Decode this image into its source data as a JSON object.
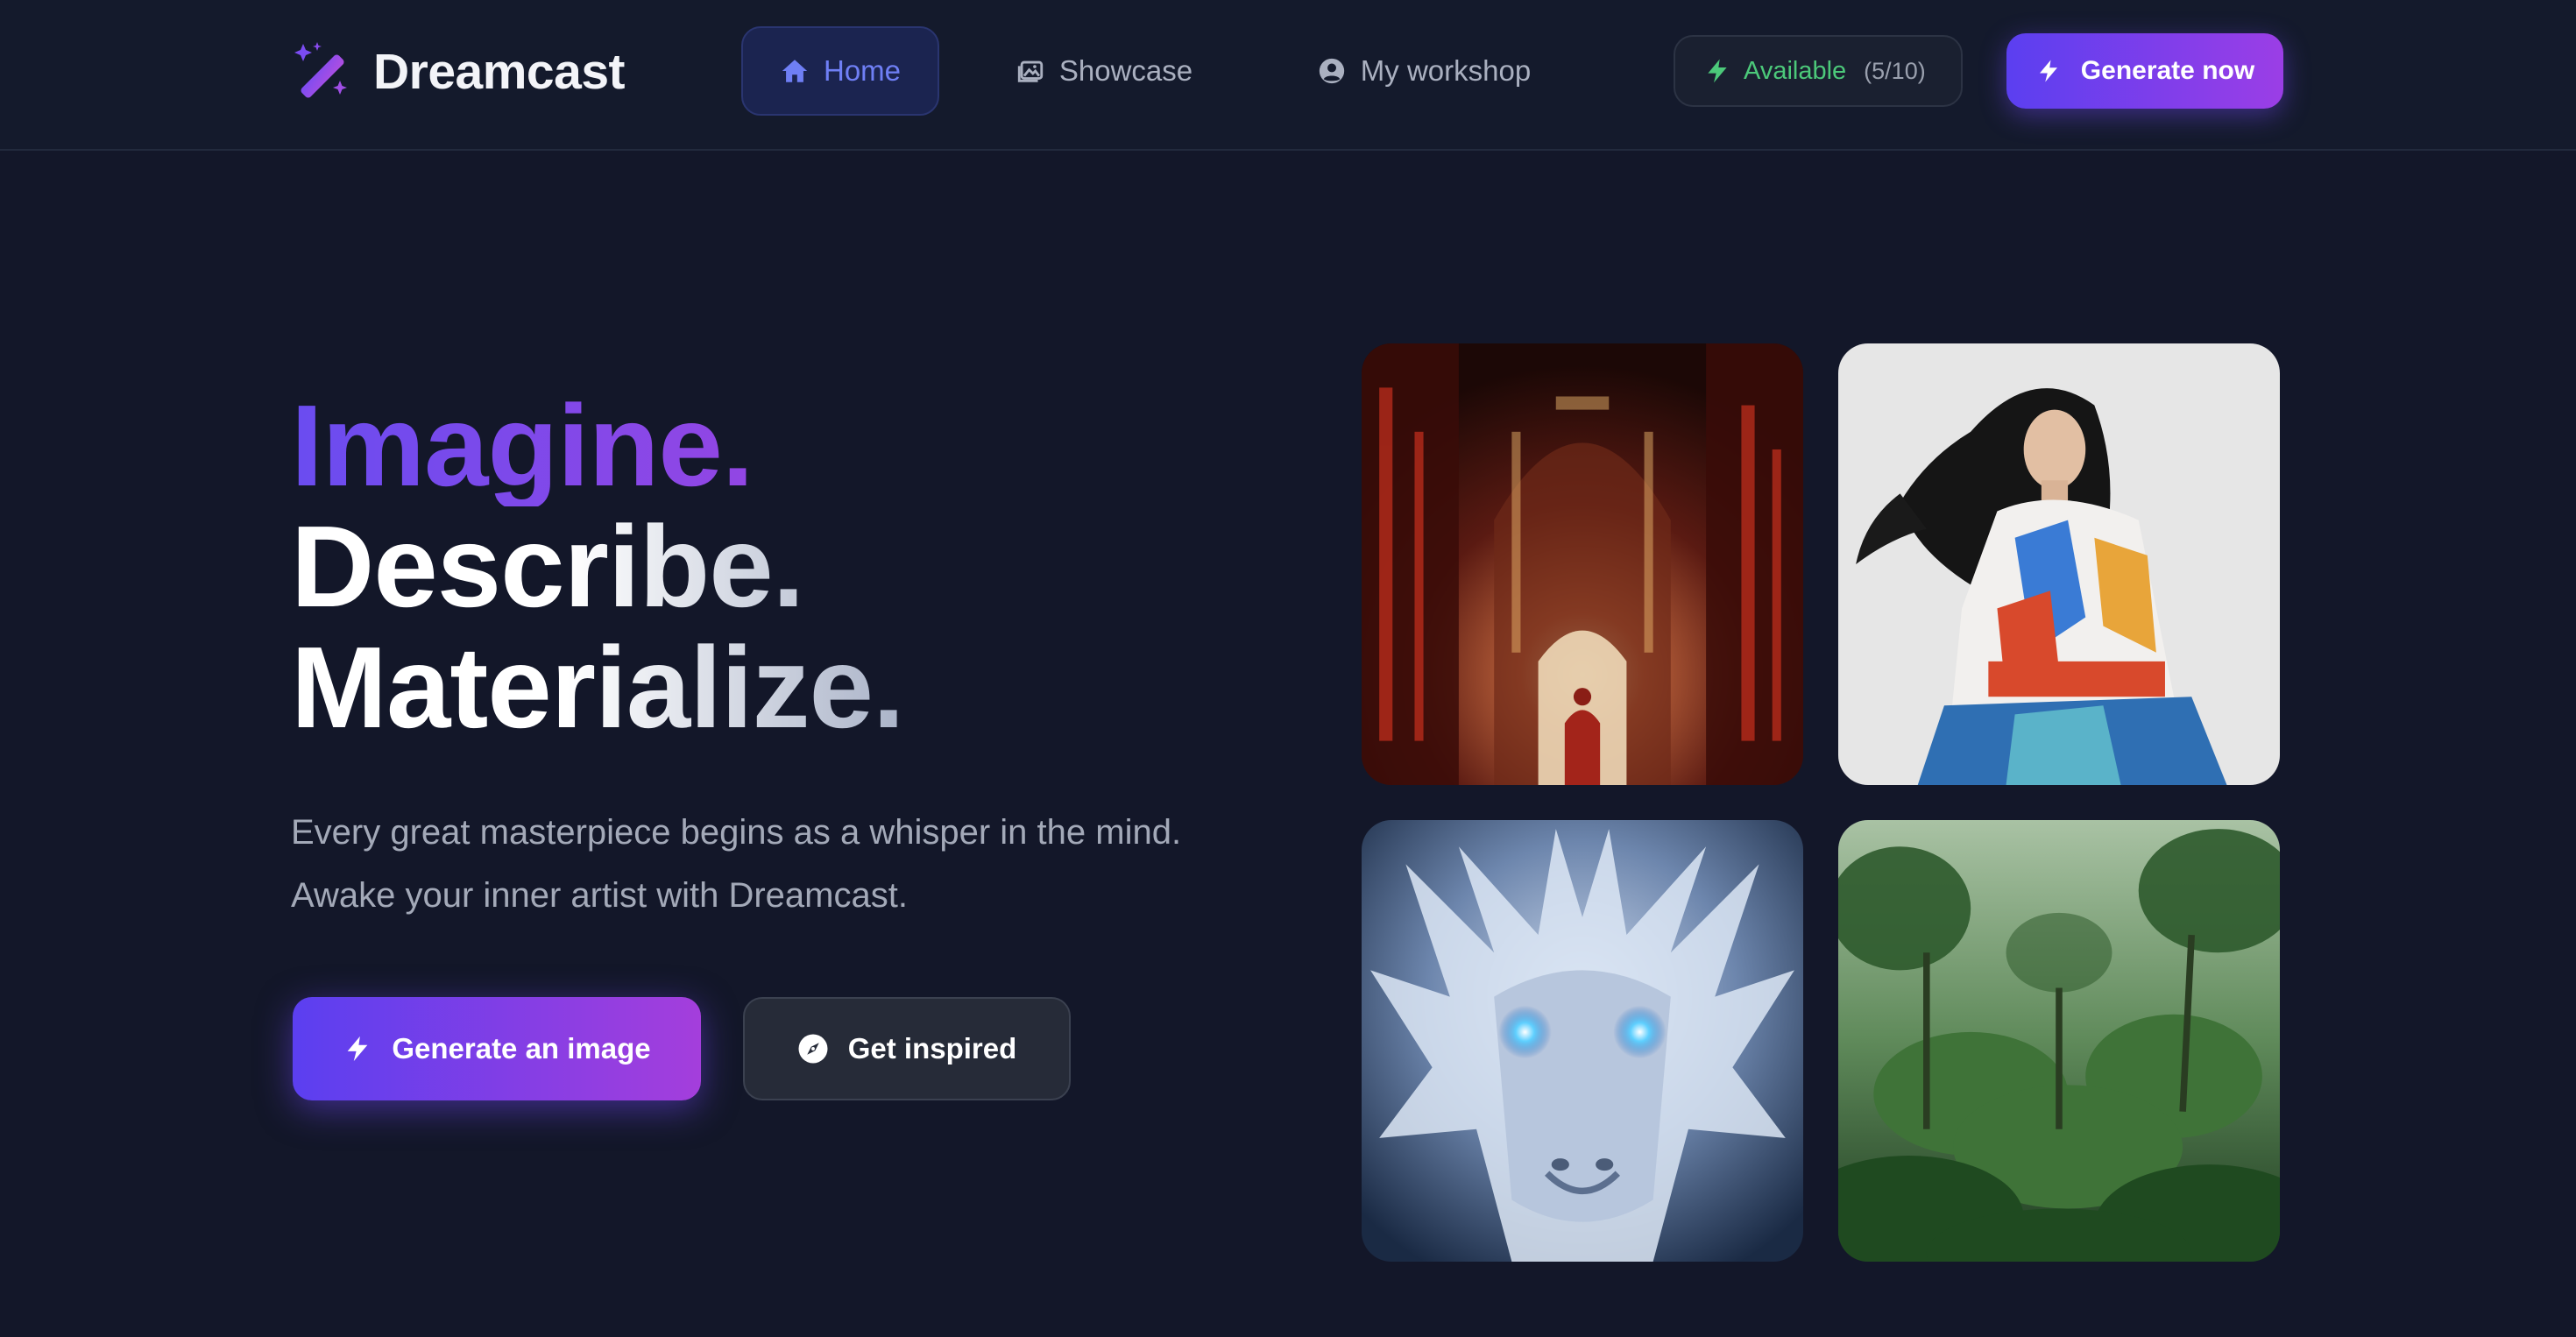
{
  "app": {
    "name": "Dreamcast",
    "logo_icon": "magic-wand-sparkles-icon",
    "accent": "#6a4cf0",
    "accent_end": "#a044e0"
  },
  "nav": {
    "items": [
      {
        "label": "Home",
        "icon": "home-icon",
        "active": true
      },
      {
        "label": "Showcase",
        "icon": "images-icon",
        "active": false
      },
      {
        "label": "My workshop",
        "icon": "user-circle-icon",
        "active": false
      }
    ],
    "availability": {
      "label": "Available",
      "count": "(5/10)",
      "icon": "bolt-icon",
      "color": "#4cc97a"
    },
    "cta": {
      "label": "Generate now",
      "icon": "bolt-icon"
    }
  },
  "hero": {
    "headline": [
      "Imagine.",
      "Describe.",
      "Materialize."
    ],
    "tagline": "Every great masterpiece begins as a whisper in the mind. Awake your inner artist with Dreamcast.",
    "primary_button": {
      "label": "Generate an image",
      "icon": "bolt-icon"
    },
    "secondary_button": {
      "label": "Get inspired",
      "icon": "compass-icon"
    }
  },
  "gallery": {
    "images": [
      {
        "subject": "gothic-cathedral-interior-red"
      },
      {
        "subject": "fashion-portrait-woman-colorful-coat"
      },
      {
        "subject": "white-dragon-glowing-blue-eyes"
      },
      {
        "subject": "misty-jungle-forest"
      }
    ]
  }
}
